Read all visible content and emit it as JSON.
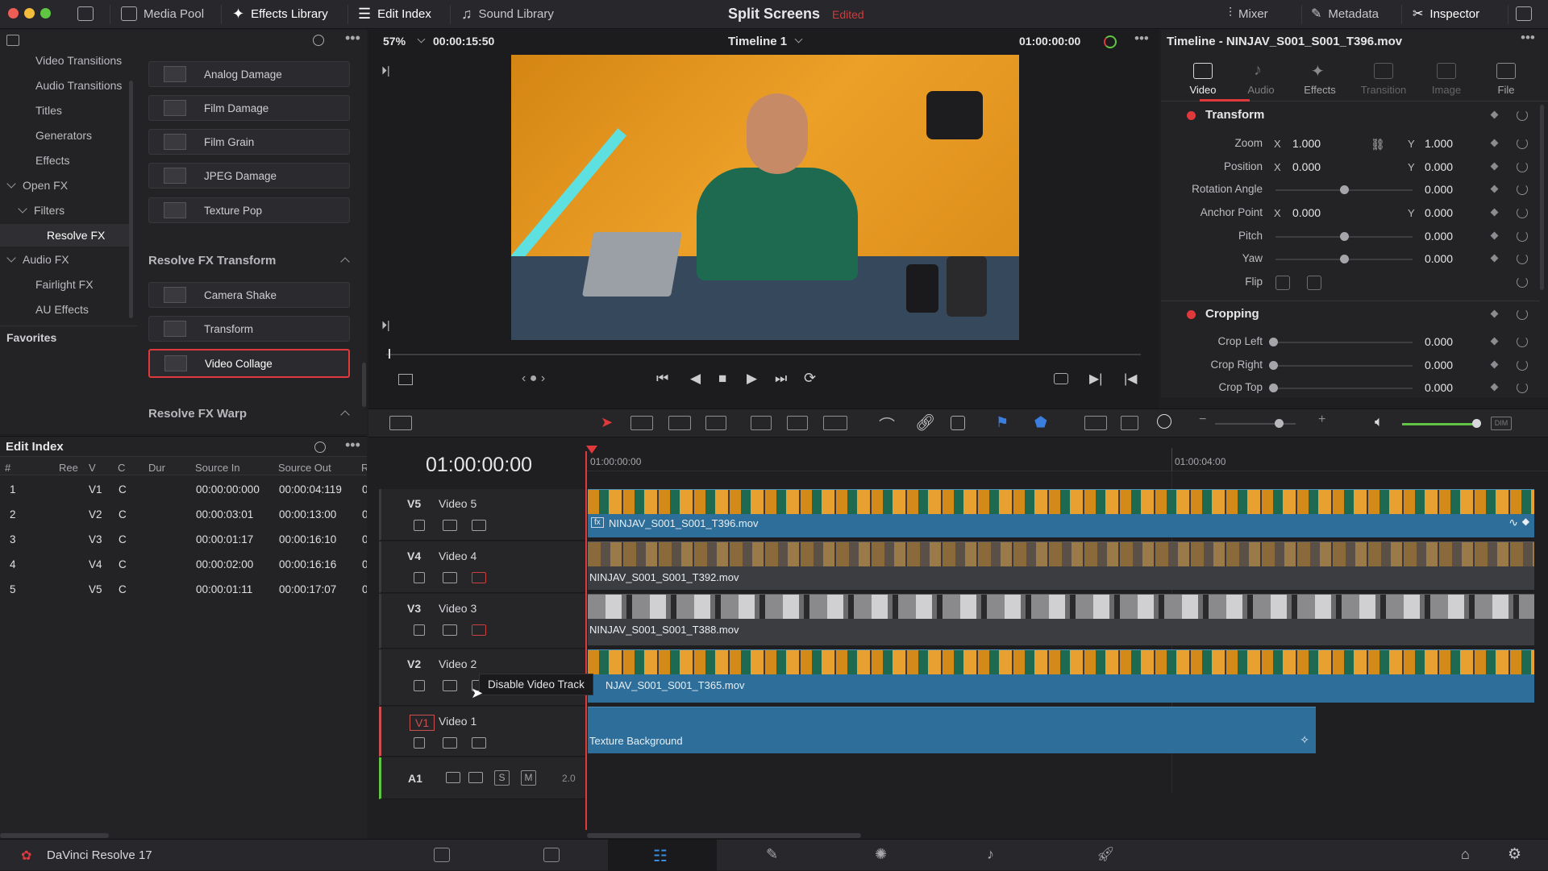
{
  "window": {
    "project_title": "Split Screens",
    "project_status": "Edited",
    "colors": {
      "accent": "#e0393b",
      "clip_blue": "#2d6f9a",
      "panel": "#232326"
    }
  },
  "toolbar": {
    "media_pool": "Media Pool",
    "effects_library": "Effects Library",
    "edit_index": "Edit Index",
    "sound_library": "Sound Library",
    "mixer": "Mixer",
    "metadata": "Metadata",
    "inspector": "Inspector"
  },
  "effects_tree": {
    "items": [
      "Video Transitions",
      "Audio Transitions",
      "Titles",
      "Generators",
      "Effects"
    ],
    "open_fx": "Open FX",
    "filters": "Filters",
    "resolve_fx": "Resolve FX",
    "audio_fx": "Audio FX",
    "fairlight_fx": "Fairlight FX",
    "au_effects": "AU Effects",
    "favorites": "Favorites"
  },
  "effects_list": {
    "items": [
      "Analog Damage",
      "Film Damage",
      "Film Grain",
      "JPEG Damage",
      "Texture Pop"
    ],
    "section_transform": "Resolve FX Transform",
    "transform_items": [
      "Camera Shake",
      "Transform",
      "Video Collage"
    ],
    "selected": "Video Collage",
    "section_warp": "Resolve FX Warp"
  },
  "edit_index": {
    "title": "Edit Index",
    "columns": [
      "#",
      "Ree",
      "V",
      "C",
      "Dur",
      "Source In",
      "Source Out",
      "Re"
    ],
    "rows": [
      {
        "n": "1",
        "v": "V1",
        "c": "C",
        "src_in": "00:00:00:000",
        "src_out": "00:00:04:119",
        "re": "0"
      },
      {
        "n": "2",
        "v": "V2",
        "c": "C",
        "src_in": "00:00:03:01",
        "src_out": "00:00:13:00",
        "re": "0"
      },
      {
        "n": "3",
        "v": "V3",
        "c": "C",
        "src_in": "00:00:01:17",
        "src_out": "00:00:16:10",
        "re": "0"
      },
      {
        "n": "4",
        "v": "V4",
        "c": "C",
        "src_in": "00:00:02:00",
        "src_out": "00:00:16:16",
        "re": "0"
      },
      {
        "n": "5",
        "v": "V5",
        "c": "C",
        "src_in": "00:00:01:11",
        "src_out": "00:00:17:07",
        "re": "0"
      }
    ]
  },
  "viewer": {
    "zoom": "57%",
    "duration": "00:00:15:50",
    "timeline_name": "Timeline 1",
    "timecode": "01:00:00:00"
  },
  "inspector": {
    "title": "Timeline - NINJAV_S001_S001_T396.mov",
    "tabs": [
      "Video",
      "Audio",
      "Effects",
      "Transition",
      "Image",
      "File"
    ],
    "active_tab": "Video",
    "transform": {
      "header": "Transform",
      "zoom_label": "Zoom",
      "zoom_x": "1.000",
      "zoom_y": "1.000",
      "position_label": "Position",
      "position_x": "0.000",
      "position_y": "0.000",
      "rotation_label": "Rotation Angle",
      "rotation": "0.000",
      "anchor_label": "Anchor Point",
      "anchor_x": "0.000",
      "anchor_y": "0.000",
      "pitch_label": "Pitch",
      "pitch": "0.000",
      "yaw_label": "Yaw",
      "yaw": "0.000",
      "flip_label": "Flip",
      "x": "X",
      "y": "Y"
    },
    "cropping": {
      "header": "Cropping",
      "left_label": "Crop Left",
      "left": "0.000",
      "right_label": "Crop Right",
      "right": "0.000",
      "top_label": "Crop Top",
      "top": "0.000"
    }
  },
  "timeline": {
    "timecode": "01:00:00:00",
    "ruler": [
      "01:00:00:00",
      "01:00:04:00"
    ],
    "tracks": [
      {
        "id": "V5",
        "name": "Video 5",
        "clip": "NINJAV_S001_S001_T396.mov"
      },
      {
        "id": "V4",
        "name": "Video 4",
        "clip": "NINJAV_S001_S001_T392.mov"
      },
      {
        "id": "V3",
        "name": "Video 3",
        "clip": "NINJAV_S001_S001_T388.mov"
      },
      {
        "id": "V2",
        "name": "Video 2",
        "clip": "NJAV_S001_S001_T365.mov"
      },
      {
        "id": "V1",
        "name": "Video 1",
        "clip": "Texture Background"
      }
    ],
    "audio": {
      "id": "A1",
      "solo": "S",
      "mute": "M",
      "channels": "2.0"
    },
    "tooltip": "Disable Video Track",
    "fx_badge": "fx"
  },
  "app": {
    "name": "DaVinci Resolve 17"
  }
}
